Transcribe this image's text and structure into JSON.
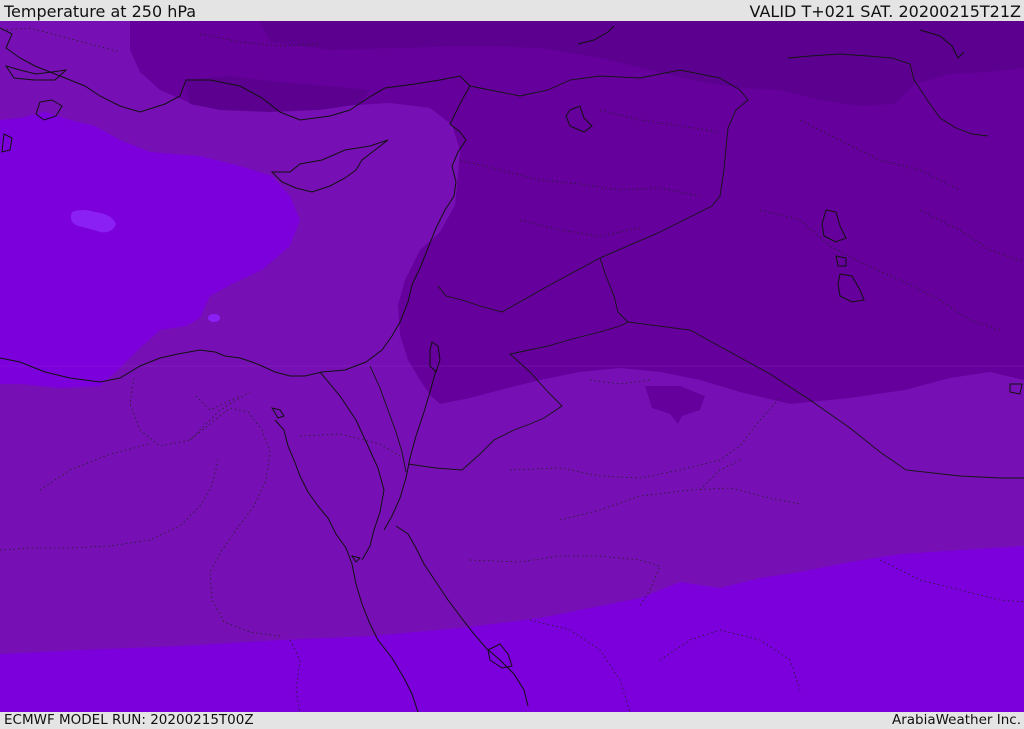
{
  "header": {
    "title": "Temperature at 250 hPa",
    "valid_time": "VALID T+021 SAT. 20200215T21Z"
  },
  "footer": {
    "model_run": "ECMWF MODEL RUN: 20200215T00Z",
    "credit": "ArabiaWeather Inc."
  },
  "colors": {
    "band_very_cold": "#5c0090",
    "band_cold": "#66009c",
    "band_mid": "#7710b4",
    "band_warm": "#7c00dc",
    "band_warmest": "#8a20f4",
    "coastline": "#111111",
    "border": "#151515",
    "background_bar": "#e4e4e4"
  }
}
